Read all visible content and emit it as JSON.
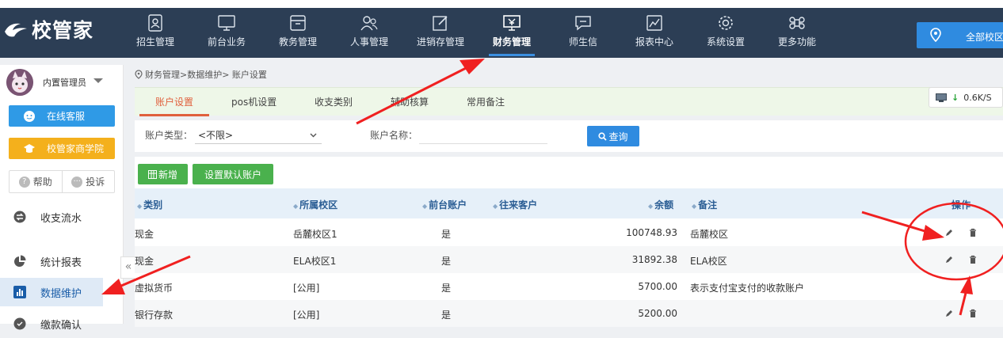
{
  "app": {
    "logo_text": "校管家"
  },
  "nav": [
    {
      "label": "招生管理",
      "icon": "user-badge-icon"
    },
    {
      "label": "前台业务",
      "icon": "monitor-icon"
    },
    {
      "label": "教务管理",
      "icon": "folder-icon"
    },
    {
      "label": "人事管理",
      "icon": "people-icon"
    },
    {
      "label": "进销存管理",
      "icon": "edit-icon"
    },
    {
      "label": "财务管理",
      "icon": "finance-icon",
      "active": true
    },
    {
      "label": "师生信",
      "icon": "message-icon"
    },
    {
      "label": "报表中心",
      "icon": "report-icon"
    },
    {
      "label": "系统设置",
      "icon": "gear-icon"
    },
    {
      "label": "更多功能",
      "icon": "command-icon"
    }
  ],
  "campus_button": {
    "label": "全部校区",
    "icon": "location-pin-icon"
  },
  "sidebar": {
    "user_name": "内置管理员",
    "online_service": "在线客服",
    "academy": "校管家商学院",
    "help": "帮助",
    "complain": "投诉",
    "menu": [
      {
        "label": "收支流水",
        "icon": "exchange-icon"
      },
      {
        "label": "统计报表",
        "icon": "pie-chart-icon"
      },
      {
        "label": "数据维护",
        "icon": "bar-chart-icon",
        "active": true
      },
      {
        "label": "缴款确认",
        "icon": "confirm-icon"
      }
    ],
    "collapse_glyph": "«"
  },
  "breadcrumb": "财务管理>数据维护> 账户设置",
  "tabs": [
    "账户设置",
    "pos机设置",
    "收支类别",
    "辅助核算",
    "常用备注"
  ],
  "speed": {
    "value": "0.6K/S"
  },
  "filter": {
    "type_label": "账户类型：",
    "type_value": "<不限>",
    "name_label": "账户名称：",
    "name_value": "",
    "query_button": "查询"
  },
  "toolbar": {
    "add_button": "新增",
    "default_button": "设置默认账户"
  },
  "table": {
    "columns": [
      "类别",
      "所属校区",
      "前台账户",
      "往来客户",
      "余额",
      "备注",
      "操作"
    ],
    "rows": [
      {
        "category": "现金",
        "campus": "岳麓校区1",
        "front": "是",
        "client": "",
        "balance": "100748.93",
        "note": "岳麓校区"
      },
      {
        "category": "现金",
        "campus": "ELA校区1",
        "front": "是",
        "client": "",
        "balance": "31892.38",
        "note": "ELA校区"
      },
      {
        "category": "虚拟货币",
        "campus": "[公用]",
        "front": "是",
        "client": "",
        "balance": "5700.00",
        "note": "表示支付宝支付的收款账户"
      },
      {
        "category": "银行存款",
        "campus": "[公用]",
        "front": "是",
        "client": "",
        "balance": "5200.00",
        "note": ""
      }
    ]
  },
  "colors": {
    "topbar": "#2c3e55",
    "accent": "#2f8be0",
    "annotation": "#f02020",
    "green": "#4ab14d",
    "orange_tab": "#e0603d"
  }
}
